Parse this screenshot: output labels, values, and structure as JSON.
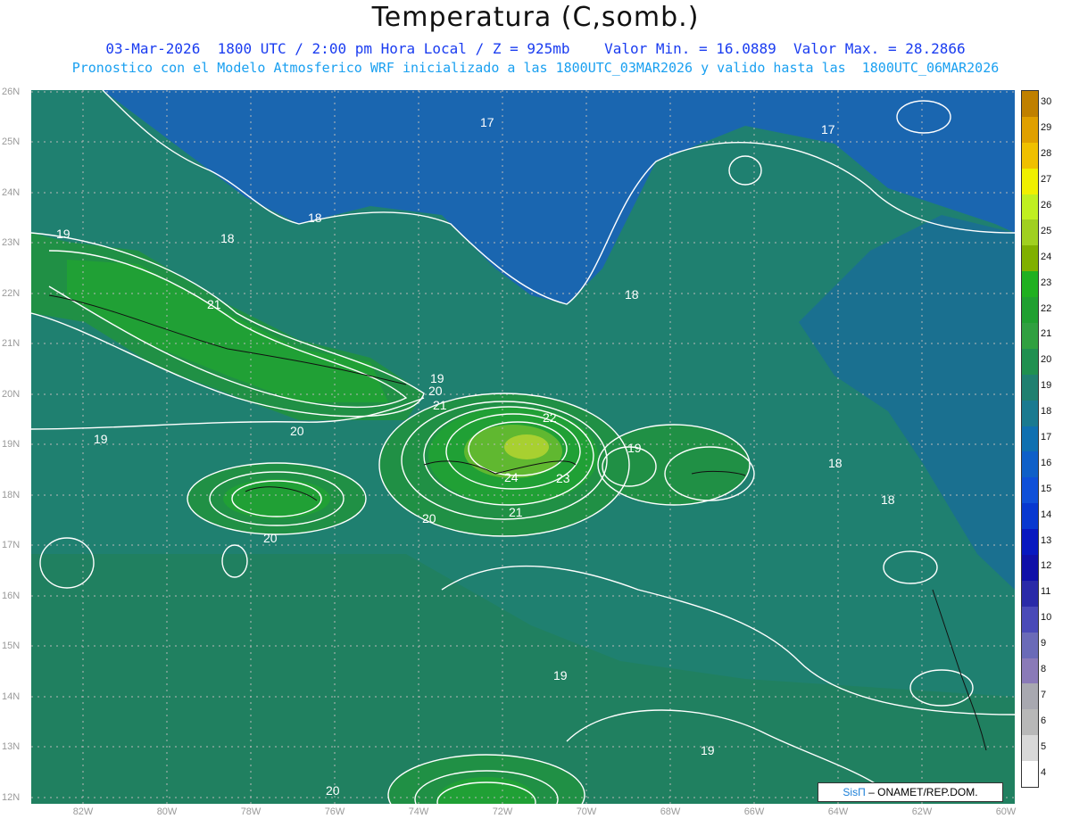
{
  "title": "Temperatura (C,somb.)",
  "subtitle_line1": "03-Mar-2026  1800 UTC / 2:00 pm Hora Local / Z = 925mb    Valor Min. = 16.0889  Valor Max. = 28.2866",
  "subtitle_line2": "Pronostico con el Modelo Atmosferico WRF inicializado a las 1800UTC_03MAR2026 y valido hasta las  1800UTC_06MAR2026",
  "lat_labels": [
    "26N",
    "25N",
    "24N",
    "23N",
    "22N",
    "21N",
    "20N",
    "19N",
    "18N",
    "17N",
    "16N",
    "15N",
    "14N",
    "13N",
    "12N"
  ],
  "lon_labels": [
    "82W",
    "80W",
    "78W",
    "76W",
    "74W",
    "72W",
    "70W",
    "68W",
    "66W",
    "64W",
    "62W",
    "60W"
  ],
  "colorbar": {
    "labels": [
      "30",
      "29",
      "28",
      "27",
      "26",
      "25",
      "24",
      "23",
      "22",
      "21",
      "20",
      "19",
      "18",
      "17",
      "16",
      "15",
      "14",
      "13",
      "12",
      "11",
      "10",
      "9",
      "8",
      "7",
      "6",
      "5",
      "4"
    ],
    "colors": [
      "#c08000",
      "#e0a000",
      "#f0c000",
      "#f0f000",
      "#c0f020",
      "#a0d020",
      "#80b000",
      "#20b020",
      "#20a030",
      "#30a040",
      "#209050",
      "#208070",
      "#1a7a90",
      "#1070b0",
      "#1060c8",
      "#1050d8",
      "#0838d0",
      "#0818c0",
      "#1010a8",
      "#2a2aa8",
      "#4a4ab8",
      "#6a6ab8",
      "#8a7ab8",
      "#a8a8b0",
      "#b8b8b8",
      "#d8d8d8",
      "#ffffff"
    ]
  },
  "contour_labels": [
    {
      "text": "17"
    },
    {
      "text": "17"
    },
    {
      "text": "18"
    },
    {
      "text": "18"
    },
    {
      "text": "18"
    },
    {
      "text": "18"
    },
    {
      "text": "18"
    },
    {
      "text": "19"
    },
    {
      "text": "19"
    },
    {
      "text": "19"
    },
    {
      "text": "19"
    },
    {
      "text": "19"
    },
    {
      "text": "20"
    },
    {
      "text": "20"
    },
    {
      "text": "20"
    },
    {
      "text": "20"
    },
    {
      "text": "21"
    },
    {
      "text": "21"
    },
    {
      "text": "21"
    },
    {
      "text": "22"
    },
    {
      "text": "23"
    },
    {
      "text": "24"
    }
  ],
  "credit": {
    "sis": "SisΠ",
    "rest": "– ONAMET/REP.DOM."
  },
  "colors": {
    "ocean_base": "#1f7a78",
    "north_blue": "#1a66b0",
    "green_core": "#20a030"
  }
}
